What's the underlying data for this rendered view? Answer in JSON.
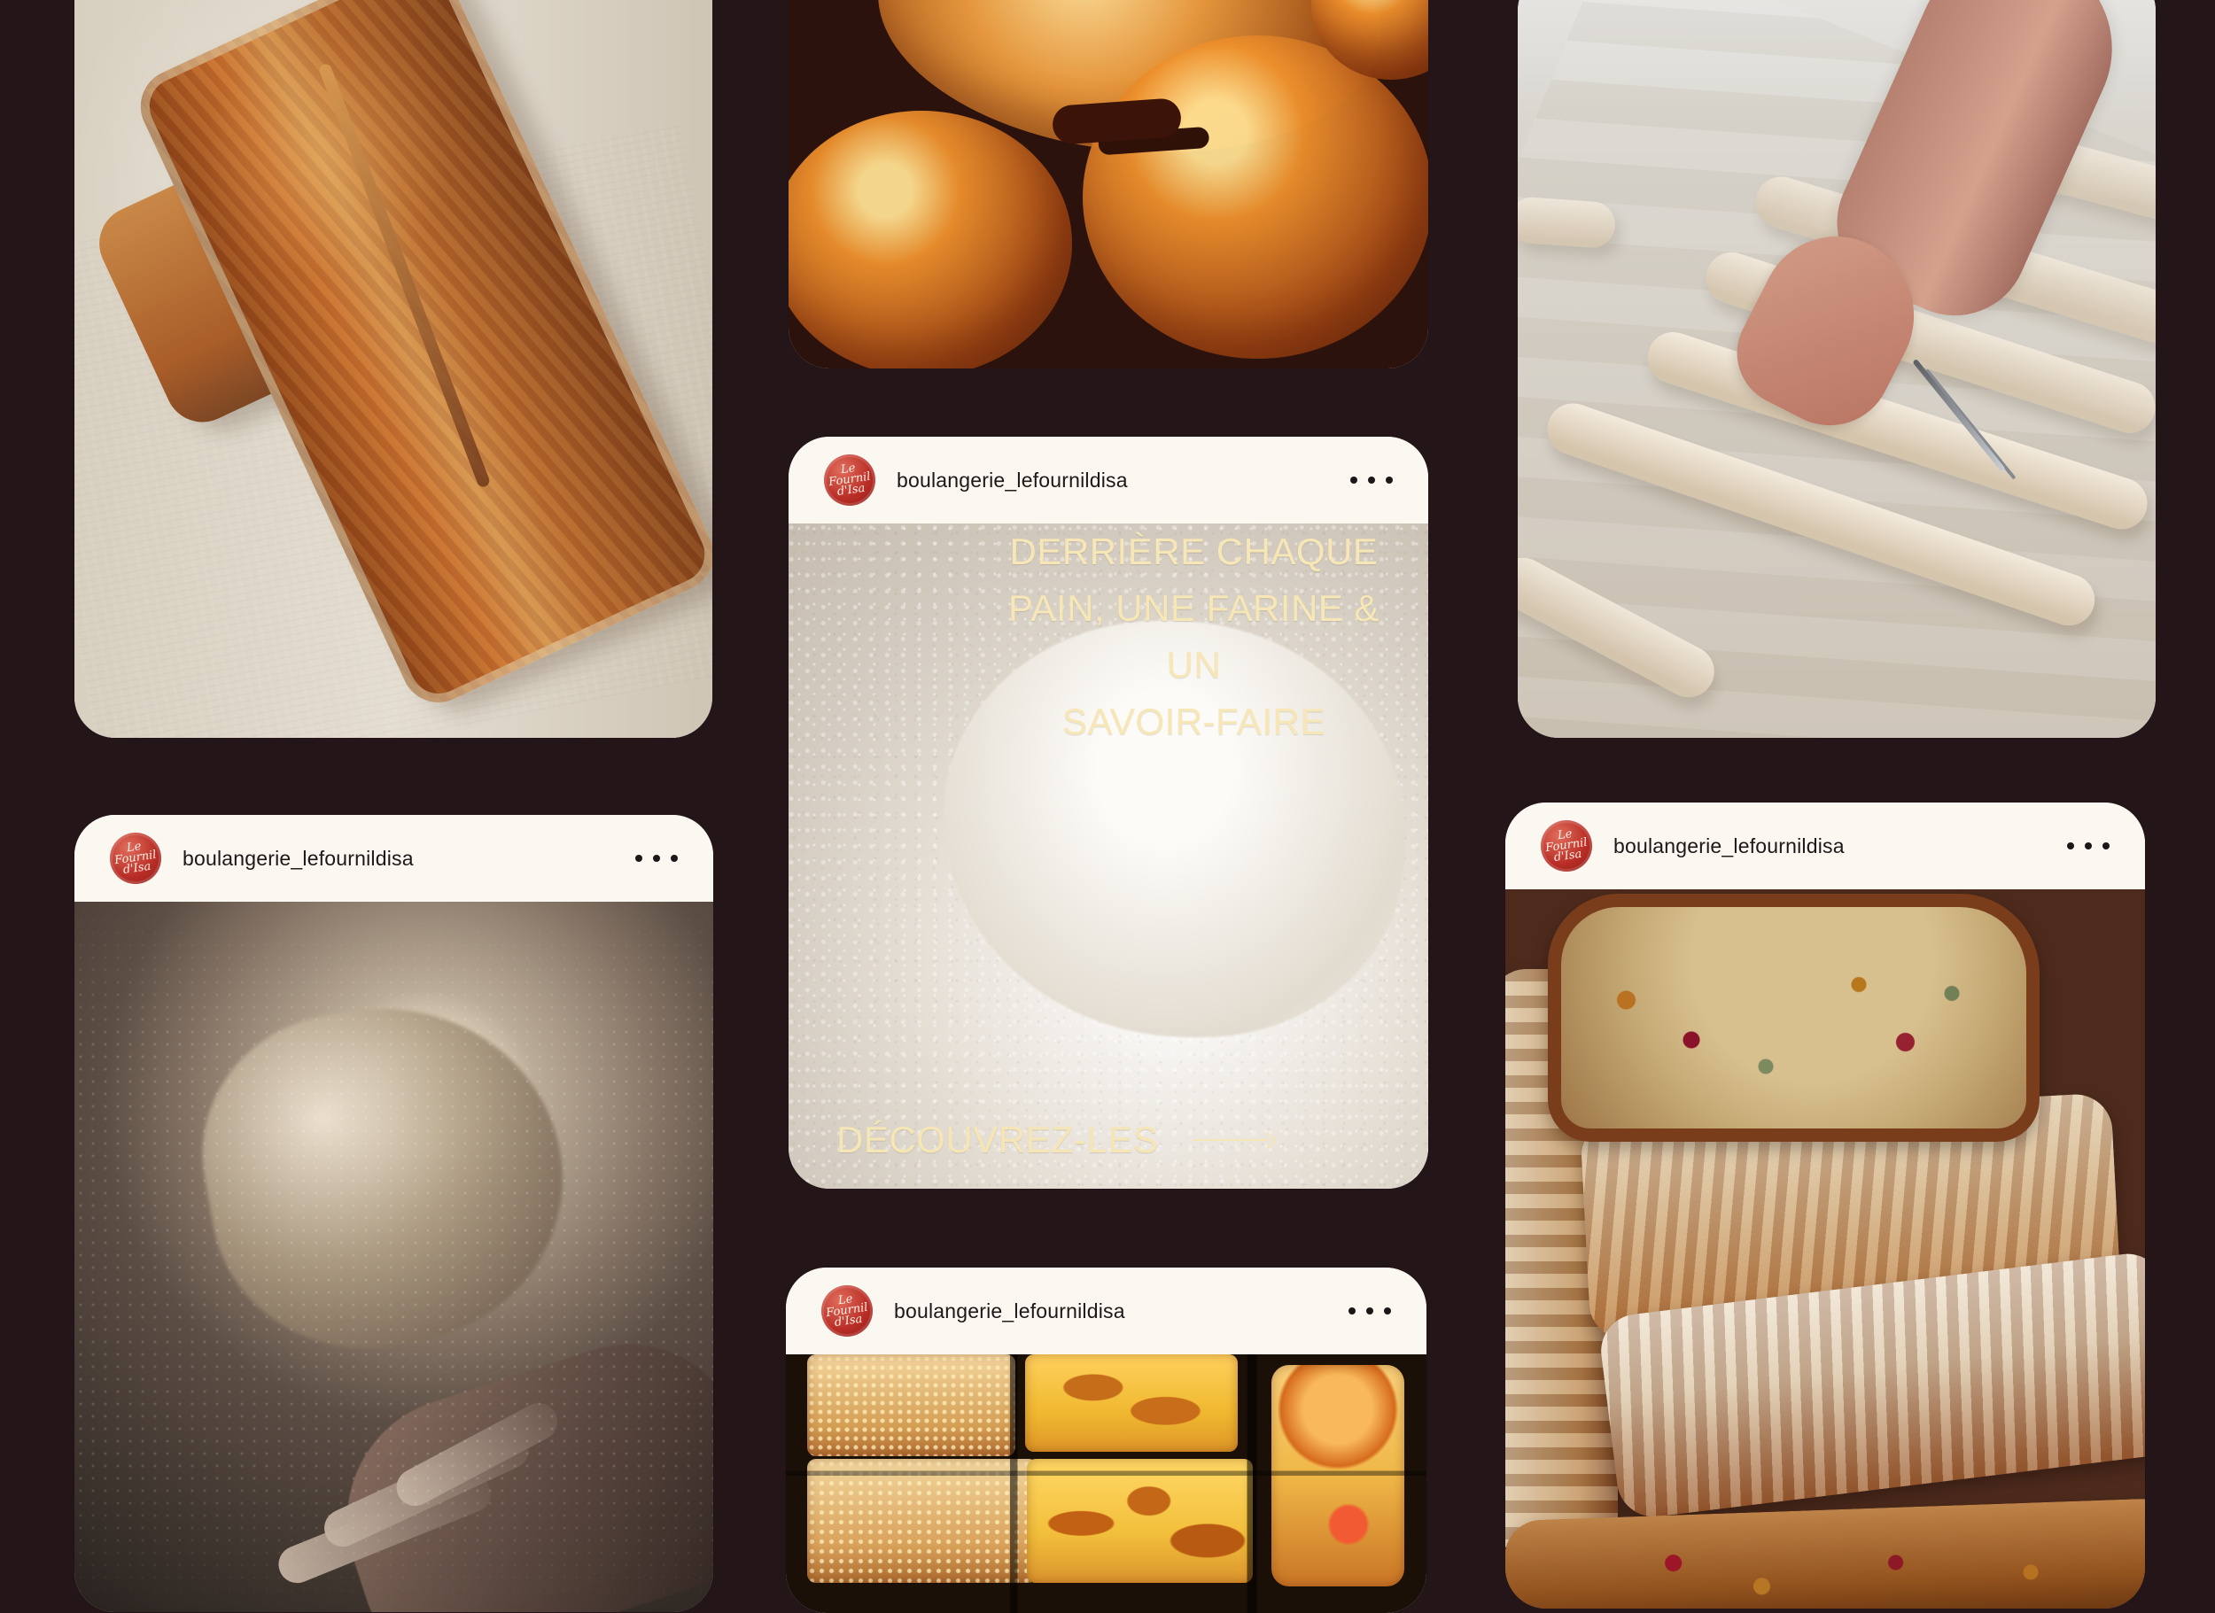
{
  "feed": {
    "handle": "boulangerie_lefournildisa",
    "avatar_text": "Le Fournil\nd'Isa"
  },
  "posts": [
    {
      "name": "bread-post",
      "image_label": "Loaves of bread on linen"
    },
    {
      "name": "pastry-post",
      "image_label": "Chocolate pastries"
    },
    {
      "name": "baguette-post",
      "image_label": "Baguette dough being scored"
    },
    {
      "name": "flour-post",
      "handle": "boulangerie_lefournildisa",
      "overlay_title": "DERRIÈRE CHAQUE\nPAIN, UNE FARINE & UN\nSAVOIR-FAIRE",
      "cta": "DÉCOUVREZ-LES"
    },
    {
      "name": "dough-post",
      "handle": "boulangerie_lefournildisa"
    },
    {
      "name": "fruit-bread-post",
      "handle": "boulangerie_lefournildisa"
    },
    {
      "name": "tart-post",
      "handle": "boulangerie_lefournildisa"
    }
  ],
  "colors": {
    "background": "#241519",
    "card_header": "#fbf8f1",
    "avatar_red": "#b92e26",
    "overlay_text": "#f7e6b6"
  },
  "icons": {
    "more": "more-options-icon",
    "arrow": "arrow-right-icon"
  }
}
